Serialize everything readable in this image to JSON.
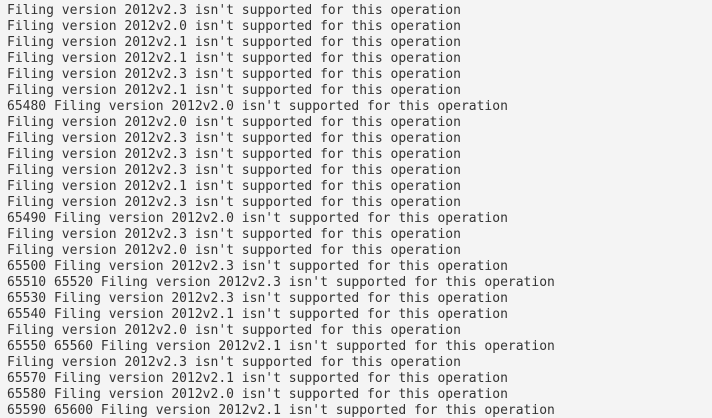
{
  "console": {
    "lines": [
      "Filing version 2012v2.3 isn't supported for this operation",
      "Filing version 2012v2.0 isn't supported for this operation",
      "Filing version 2012v2.1 isn't supported for this operation",
      "Filing version 2012v2.1 isn't supported for this operation",
      "Filing version 2012v2.3 isn't supported for this operation",
      "Filing version 2012v2.1 isn't supported for this operation",
      "65480 Filing version 2012v2.0 isn't supported for this operation",
      "Filing version 2012v2.0 isn't supported for this operation",
      "Filing version 2012v2.3 isn't supported for this operation",
      "Filing version 2012v2.3 isn't supported for this operation",
      "Filing version 2012v2.3 isn't supported for this operation",
      "Filing version 2012v2.1 isn't supported for this operation",
      "Filing version 2012v2.3 isn't supported for this operation",
      "65490 Filing version 2012v2.0 isn't supported for this operation",
      "Filing version 2012v2.3 isn't supported for this operation",
      "Filing version 2012v2.0 isn't supported for this operation",
      "65500 Filing version 2012v2.3 isn't supported for this operation",
      "65510 65520 Filing version 2012v2.3 isn't supported for this operation",
      "65530 Filing version 2012v2.3 isn't supported for this operation",
      "65540 Filing version 2012v2.1 isn't supported for this operation",
      "Filing version 2012v2.0 isn't supported for this operation",
      "65550 65560 Filing version 2012v2.1 isn't supported for this operation",
      "Filing version 2012v2.3 isn't supported for this operation",
      "65570 Filing version 2012v2.1 isn't supported for this operation",
      "65580 Filing version 2012v2.0 isn't supported for this operation",
      "65590 65600 Filing version 2012v2.1 isn't supported for this operation"
    ]
  }
}
